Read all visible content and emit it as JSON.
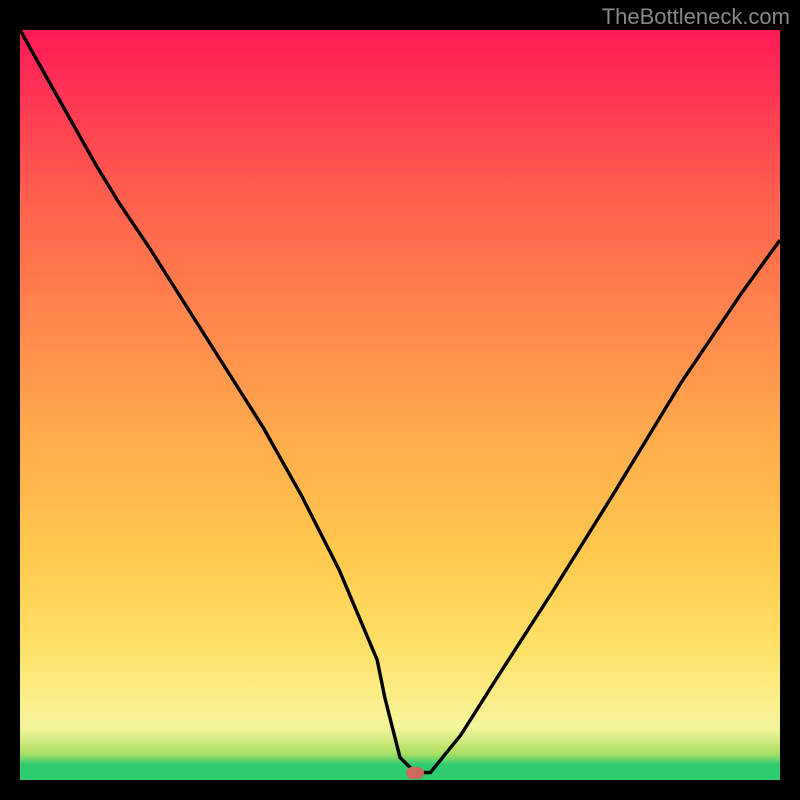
{
  "watermark": "TheBottleneck.com",
  "chart_data": {
    "type": "line",
    "title": "",
    "xlabel": "",
    "ylabel": "",
    "xlim": [
      0,
      100
    ],
    "ylim": [
      0,
      100
    ],
    "series": [
      {
        "name": "bottleneck-curve",
        "x": [
          0,
          5,
          10,
          13,
          17,
          22,
          27,
          32,
          37,
          42,
          47,
          48,
          50,
          52,
          54,
          58,
          63,
          70,
          78,
          87,
          95,
          100
        ],
        "values": [
          100,
          91,
          82,
          77,
          71,
          63,
          55,
          47,
          38,
          28,
          16,
          11,
          3,
          1,
          1,
          6,
          14,
          25,
          38,
          53,
          65,
          72
        ]
      },
      {
        "name": "flat-bottom",
        "x": [
          47,
          52
        ],
        "values": [
          1,
          1
        ]
      }
    ],
    "marker": {
      "x": 52,
      "y": 1
    },
    "colors": {
      "curve": "#000000",
      "marker": "#c96a5c",
      "gradient_top": "#ff1a55",
      "gradient_bottom": "#2ecc71"
    }
  }
}
